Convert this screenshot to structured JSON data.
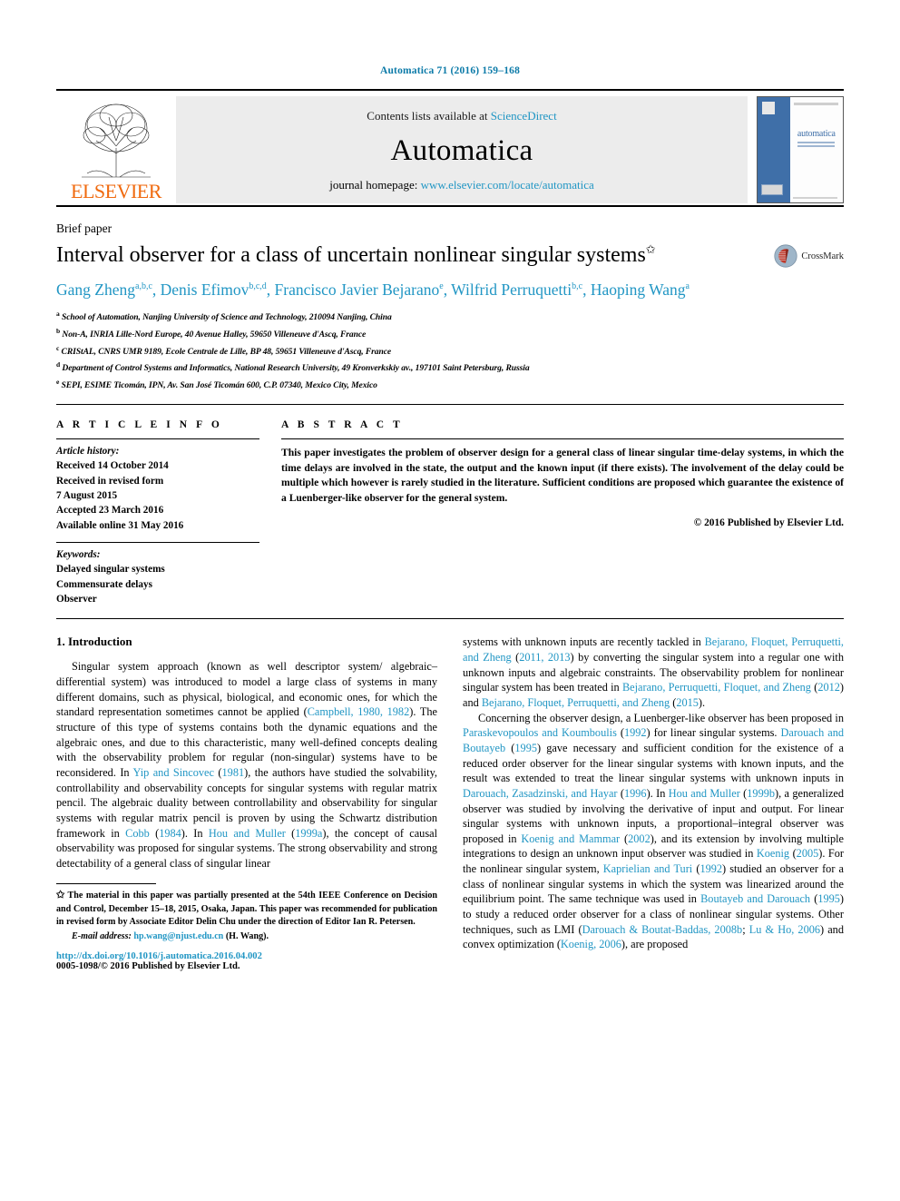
{
  "running_head": "Automatica 71 (2016) 159–168",
  "masthead": {
    "publisher_name": "ELSEVIER",
    "contents_prefix": "Contents lists available at ",
    "contents_link": "ScienceDirect",
    "journal_name": "Automatica",
    "homepage_prefix": "journal homepage: ",
    "homepage_url": "www.elsevier.com/locate/automatica",
    "cover_title": "automatica",
    "colors": {
      "link": "#2196c4",
      "elsevier_orange": "#f06a0f",
      "cover_blue": "#3f6fa8"
    }
  },
  "article": {
    "type_label": "Brief paper",
    "title": "Interval observer for a class of uncertain nonlinear singular systems",
    "title_footnote_marker": "✩",
    "crossmark_label": "CrossMark",
    "authors": [
      {
        "name": "Gang Zheng",
        "affil": "a,b,c",
        "sep": ", "
      },
      {
        "name": "Denis Efimov",
        "affil": "b,c,d",
        "sep": ", "
      },
      {
        "name": "Francisco Javier Bejarano",
        "affil": "e",
        "sep": ", "
      },
      {
        "name": "Wilfrid Perruquetti",
        "affil": "b,c",
        "sep": ", "
      },
      {
        "name": "Haoping Wang",
        "affil": "a",
        "sep": ""
      }
    ],
    "affiliations": [
      {
        "mark": "a",
        "text": "School of Automation, Nanjing University of Science and Technology, 210094 Nanjing, China"
      },
      {
        "mark": "b",
        "text": "Non-A, INRIA Lille-Nord Europe, 40 Avenue Halley, 59650 Villeneuve d'Ascq, France"
      },
      {
        "mark": "c",
        "text": "CRIStAL, CNRS UMR 9189, Ecole Centrale de Lille, BP 48, 59651 Villeneuve d'Ascq, France"
      },
      {
        "mark": "d",
        "text": "Department of Control Systems and Informatics, National Research University, 49 Kronverkskiy av., 197101 Saint Petersburg, Russia"
      },
      {
        "mark": "e",
        "text": "SEPI, ESIME Ticomán, IPN, Av. San José Ticomán 600, C.P. 07340, Mexico City, Mexico"
      }
    ]
  },
  "article_info": {
    "heading": "A R T I C L E    I N F O",
    "history_label": "Article history:",
    "history": [
      "Received 14 October 2014",
      "Received in revised form",
      "7 August 2015",
      "Accepted 23 March 2016",
      "Available online 31 May 2016"
    ],
    "keywords_label": "Keywords:",
    "keywords": [
      "Delayed singular systems",
      "Commensurate delays",
      "Observer"
    ]
  },
  "abstract": {
    "heading": "A B S T R A C T",
    "text": "This paper investigates the problem of observer design for a general class of linear singular time-delay systems, in which the time delays are involved in the state, the output and the known input (if there exists). The involvement of the delay could be multiple which however is rarely studied in the literature. Sufficient conditions are proposed which guarantee the existence of a Luenberger-like observer for the general system.",
    "copyright": "© 2016 Published by Elsevier Ltd."
  },
  "body": {
    "section_title": "1. Introduction",
    "left_paragraph_1": "Singular system approach (known as well descriptor system/ algebraic–differential system) was introduced to model a large class of systems in many different domains, such as physical, biological, and economic ones, for which the standard representation sometimes cannot be applied (Campbell, 1980, 1982). The structure of this type of systems contains both the dynamic equations and the algebraic ones, and due to this characteristic, many well-defined concepts dealing with the observability problem for regular (non-singular) systems have to be reconsidered. In Yip and Sincovec (1981), the authors have studied the solvability, controllability and observability concepts for singular systems with regular matrix pencil. The algebraic duality between controllability and observability for singular systems with regular matrix pencil is proven by using the Schwartz distribution framework in Cobb (1984). In Hou and Muller (1999a), the concept of causal observability was proposed for singular systems. The strong observability and strong detectability of a general class of singular linear",
    "right_paragraph_1": "systems with unknown inputs are recently tackled in Bejarano, Floquet, Perruquetti, and Zheng (2011, 2013) by converting the singular system into a regular one with unknown inputs and algebraic constraints. The observability problem for nonlinear singular system has been treated in Bejarano, Perruquetti, Floquet, and Zheng (2012) and Bejarano, Floquet, Perruquetti, and Zheng (2015).",
    "right_paragraph_2": "Concerning the observer design, a Luenberger-like observer has been proposed in Paraskevopoulos and Koumboulis (1992) for linear singular systems. Darouach and Boutayeb (1995) gave necessary and sufficient condition for the existence of a reduced order observer for the linear singular systems with known inputs, and the result was extended to treat the linear singular systems with unknown inputs in Darouach, Zasadzinski, and Hayar (1996). In Hou and Muller (1999b), a generalized observer was studied by involving the derivative of input and output. For linear singular systems with unknown inputs, a proportional–integral observer was proposed in Koenig and Mammar (2002), and its extension by involving multiple integrations to design an unknown input observer was studied in Koenig (2005). For the nonlinear singular system, Kaprielian and Turi (1992) studied an observer for a class of nonlinear singular systems in which the system was linearized around the equilibrium point. The same technique was used in Boutayeb and Darouach (1995) to study a reduced order observer for a class of nonlinear singular systems. Other techniques, such as LMI (Darouach & Boutat-Baddas, 2008b; Lu & Ho, 2006) and convex optimization (Koenig, 2006), are proposed"
  },
  "footnotes": {
    "star_marker": "✩",
    "star_text": "The material in this paper was partially presented at the 54th IEEE Conference on Decision and Control, December 15–18, 2015, Osaka, Japan. This paper was recommended for publication in revised form by Associate Editor Delin Chu under the direction of Editor Ian R. Petersen.",
    "email_label": "E-mail address:",
    "email": "hp.wang@njust.edu.cn",
    "email_author": " (H. Wang).",
    "doi": "http://dx.doi.org/10.1016/j.automatica.2016.04.002",
    "issn_line": "0005-1098/© 2016 Published by Elsevier Ltd."
  }
}
